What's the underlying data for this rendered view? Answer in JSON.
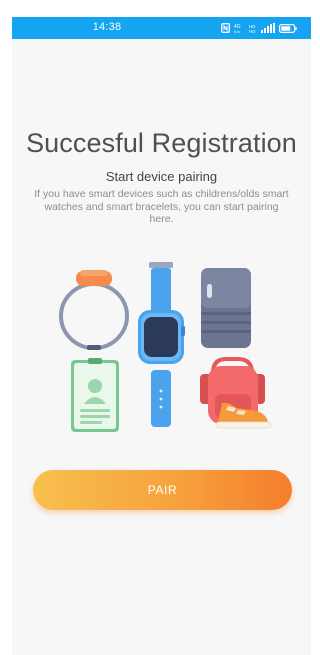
{
  "status_bar": {
    "time": "14:38",
    "background": "#14a4f2",
    "icons": [
      "nfc-icon",
      "network-speed-icon",
      "hd-volte-icon",
      "signal-icon",
      "battery-icon"
    ]
  },
  "main": {
    "title": "Succesful Registration",
    "subtitle": "Start device pairing",
    "description": "If you have smart devices such as childrens/olds smart watches and smart bracelets, you can start pairing here."
  },
  "illustration": {
    "devices": [
      "fitness-band-icon",
      "smart-watch-icon",
      "tracker-device-icon",
      "id-card-icon",
      "backpack-icon",
      "sneaker-icon"
    ]
  },
  "actions": {
    "pair_label": "PAIR",
    "gradient_start": "#f7c04e",
    "gradient_end": "#f47e2c"
  }
}
